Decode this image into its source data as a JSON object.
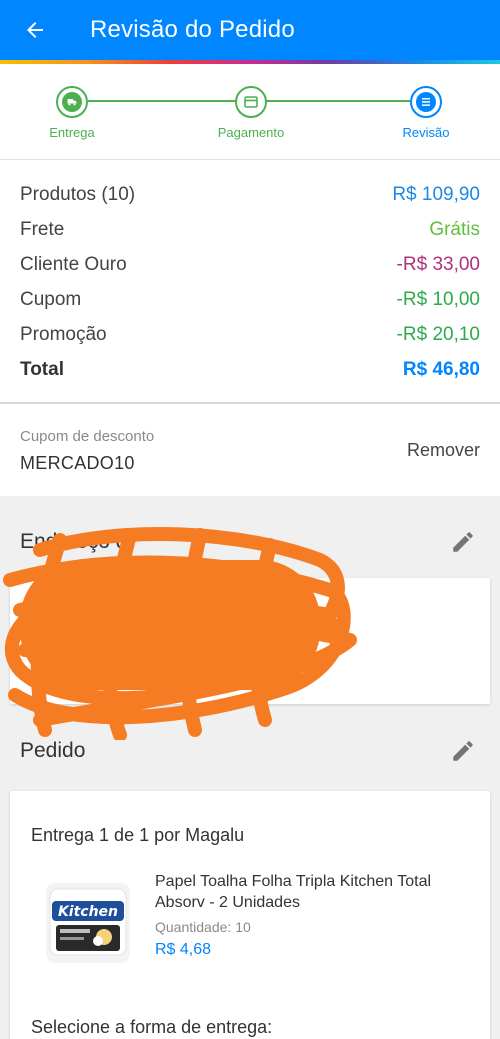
{
  "header": {
    "title": "Revisão do Pedido",
    "back_icon": "arrow-left-icon"
  },
  "stepper": {
    "steps": [
      {
        "label": "Entrega",
        "icon": "truck-icon",
        "state": "done"
      },
      {
        "label": "Pagamento",
        "icon": "card-icon",
        "state": "done"
      },
      {
        "label": "Revisão",
        "icon": "list-icon",
        "state": "active"
      }
    ]
  },
  "summary": {
    "rows": [
      {
        "label": "Produtos (10)",
        "value": "R$ 109,90",
        "color": "#1e88e5"
      },
      {
        "label": "Frete",
        "value": "Grátis",
        "color": "#5fbf3a"
      },
      {
        "label": "Cliente Ouro",
        "value": "-R$ 33,00",
        "color": "#b0307e"
      },
      {
        "label": "Cupom",
        "value": "-R$ 10,00",
        "color": "#2faa4a"
      },
      {
        "label": "Promoção",
        "value": "-R$ 20,10",
        "color": "#2faa4a"
      }
    ],
    "total": {
      "label": "Total",
      "value": "R$ 46,80"
    }
  },
  "coupon": {
    "label": "Cupom de desconto",
    "code": "MERCADO10",
    "remove_label": "Remover"
  },
  "address": {
    "title": "Endereço d"
  },
  "order": {
    "title": "Pedido",
    "delivery": "Entrega 1 de 1 por Magalu",
    "product": {
      "name": "Papel Toalha Folha Tripla Kitchen Total Absorv - 2 Unidades",
      "quantity_label": "Quantidade:",
      "quantity": "10",
      "price": "R$ 4,68",
      "brand_text": "Kitchen"
    },
    "select_shipping": "Selecione a forma de entrega:"
  }
}
